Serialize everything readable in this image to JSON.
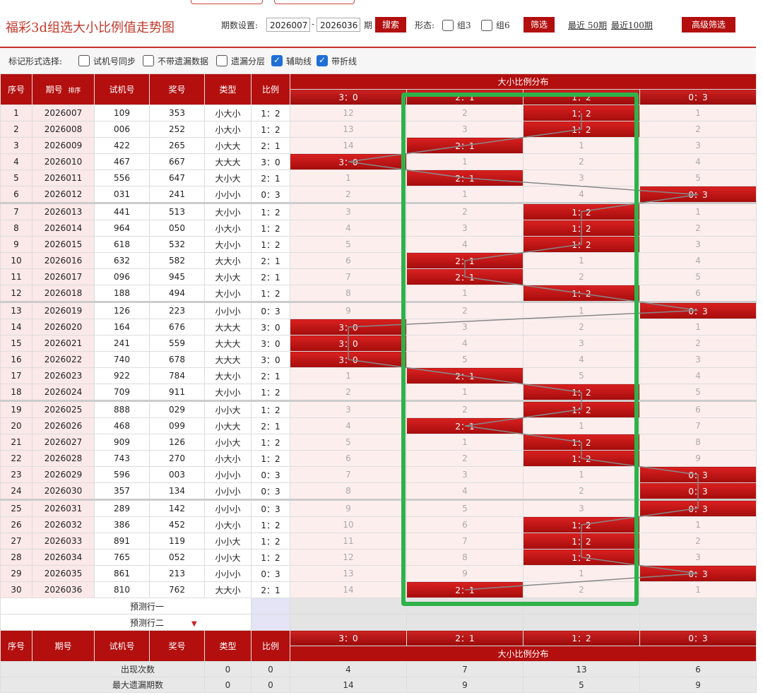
{
  "page": {
    "title": "福彩3d组选大小比例值走势图",
    "period_label": "期数设置:",
    "period_start": "2026007",
    "period_dash": "-",
    "period_end": "2026036",
    "period_unit": "期",
    "search_btn": "搜索",
    "form_label": "形态:",
    "group3": "组3",
    "group6": "组6",
    "filter_btn": "筛选",
    "recent50": "最近 50期",
    "recent100": "最近100期",
    "advanced_btn": "高级筛选"
  },
  "options": {
    "label": "标记形式选择:",
    "items": [
      {
        "label": "试机号同步",
        "checked": false
      },
      {
        "label": "不带遗漏数据",
        "checked": false
      },
      {
        "label": "遗漏分层",
        "checked": false
      },
      {
        "label": "辅助线",
        "checked": true
      },
      {
        "label": "带折线",
        "checked": true
      }
    ]
  },
  "table": {
    "headers": {
      "seq": "序号",
      "period": "期号",
      "sort": "排序",
      "test_no": "试机号",
      "prize_no": "奖号",
      "type": "类型",
      "ratio": "比例",
      "dist_title": "大小比例分布",
      "dist_cols": [
        "3：0",
        "2：1",
        "1：2",
        "0：3"
      ]
    },
    "rows": [
      {
        "seq": "1",
        "period": "2026007",
        "test": "109",
        "prize": "353",
        "type": "小大小",
        "ratio": "1：2",
        "dist": [
          "12",
          "2",
          "1：2",
          "1"
        ],
        "hit": 2
      },
      {
        "seq": "2",
        "period": "2026008",
        "test": "006",
        "prize": "252",
        "type": "小大小",
        "ratio": "1：2",
        "dist": [
          "13",
          "3",
          "1：2",
          "2"
        ],
        "hit": 2
      },
      {
        "seq": "3",
        "period": "2026009",
        "test": "422",
        "prize": "265",
        "type": "小大大",
        "ratio": "2：1",
        "dist": [
          "14",
          "2：1",
          "1",
          "3"
        ],
        "hit": 1
      },
      {
        "seq": "4",
        "period": "2026010",
        "test": "467",
        "prize": "667",
        "type": "大大大",
        "ratio": "3：0",
        "dist": [
          "3：0",
          "1",
          "2",
          "4"
        ],
        "hit": 0
      },
      {
        "seq": "5",
        "period": "2026011",
        "test": "556",
        "prize": "647",
        "type": "大小大",
        "ratio": "2：1",
        "dist": [
          "1",
          "2：1",
          "3",
          "5"
        ],
        "hit": 1
      },
      {
        "seq": "6",
        "period": "2026012",
        "test": "031",
        "prize": "241",
        "type": "小小小",
        "ratio": "0：3",
        "dist": [
          "2",
          "1",
          "4",
          "0：3"
        ],
        "hit": 3
      },
      {
        "seq": "7",
        "period": "2026013",
        "test": "441",
        "prize": "513",
        "type": "大小小",
        "ratio": "1：2",
        "dist": [
          "3",
          "2",
          "1：2",
          "1"
        ],
        "hit": 2
      },
      {
        "seq": "8",
        "period": "2026014",
        "test": "964",
        "prize": "050",
        "type": "小大小",
        "ratio": "1：2",
        "dist": [
          "4",
          "3",
          "1：2",
          "2"
        ],
        "hit": 2
      },
      {
        "seq": "9",
        "period": "2026015",
        "test": "618",
        "prize": "532",
        "type": "大小小",
        "ratio": "1：2",
        "dist": [
          "5",
          "4",
          "1：2",
          "3"
        ],
        "hit": 2
      },
      {
        "seq": "10",
        "period": "2026016",
        "test": "632",
        "prize": "582",
        "type": "大大小",
        "ratio": "2：1",
        "dist": [
          "6",
          "2：1",
          "1",
          "4"
        ],
        "hit": 1
      },
      {
        "seq": "11",
        "period": "2026017",
        "test": "096",
        "prize": "945",
        "type": "大小大",
        "ratio": "2：1",
        "dist": [
          "7",
          "2：1",
          "2",
          "5"
        ],
        "hit": 1
      },
      {
        "seq": "12",
        "period": "2026018",
        "test": "188",
        "prize": "494",
        "type": "大小小",
        "ratio": "1：2",
        "dist": [
          "8",
          "1",
          "1：2",
          "6"
        ],
        "hit": 2
      },
      {
        "seq": "13",
        "period": "2026019",
        "test": "126",
        "prize": "223",
        "type": "小小小",
        "ratio": "0：3",
        "dist": [
          "9",
          "2",
          "1",
          "0：3"
        ],
        "hit": 3
      },
      {
        "seq": "14",
        "period": "2026020",
        "test": "164",
        "prize": "676",
        "type": "大大大",
        "ratio": "3：0",
        "dist": [
          "3：0",
          "3",
          "2",
          "1"
        ],
        "hit": 0
      },
      {
        "seq": "15",
        "period": "2026021",
        "test": "241",
        "prize": "559",
        "type": "大大大",
        "ratio": "3：0",
        "dist": [
          "3：0",
          "4",
          "3",
          "2"
        ],
        "hit": 0
      },
      {
        "seq": "16",
        "period": "2026022",
        "test": "740",
        "prize": "678",
        "type": "大大大",
        "ratio": "3：0",
        "dist": [
          "3：0",
          "5",
          "4",
          "3"
        ],
        "hit": 0
      },
      {
        "seq": "17",
        "period": "2026023",
        "test": "922",
        "prize": "784",
        "type": "大大小",
        "ratio": "2：1",
        "dist": [
          "1",
          "2：1",
          "5",
          "4"
        ],
        "hit": 1
      },
      {
        "seq": "18",
        "period": "2026024",
        "test": "709",
        "prize": "911",
        "type": "大小小",
        "ratio": "1：2",
        "dist": [
          "2",
          "1",
          "1：2",
          "5"
        ],
        "hit": 2
      },
      {
        "seq": "19",
        "period": "2026025",
        "test": "888",
        "prize": "029",
        "type": "小小大",
        "ratio": "1：2",
        "dist": [
          "3",
          "2",
          "1：2",
          "6"
        ],
        "hit": 2
      },
      {
        "seq": "20",
        "period": "2026026",
        "test": "468",
        "prize": "099",
        "type": "小大大",
        "ratio": "2：1",
        "dist": [
          "4",
          "2：1",
          "1",
          "7"
        ],
        "hit": 1
      },
      {
        "seq": "21",
        "period": "2026027",
        "test": "909",
        "prize": "126",
        "type": "小小大",
        "ratio": "1：2",
        "dist": [
          "5",
          "1",
          "1：2",
          "8"
        ],
        "hit": 2
      },
      {
        "seq": "22",
        "period": "2026028",
        "test": "743",
        "prize": "270",
        "type": "小大小",
        "ratio": "1：2",
        "dist": [
          "6",
          "2",
          "1：2",
          "9"
        ],
        "hit": 2
      },
      {
        "seq": "23",
        "period": "2026029",
        "test": "596",
        "prize": "003",
        "type": "小小小",
        "ratio": "0：3",
        "dist": [
          "7",
          "3",
          "1",
          "0：3"
        ],
        "hit": 3
      },
      {
        "seq": "24",
        "period": "2026030",
        "test": "357",
        "prize": "134",
        "type": "小小小",
        "ratio": "0：3",
        "dist": [
          "8",
          "4",
          "2",
          "0：3"
        ],
        "hit": 3
      },
      {
        "seq": "25",
        "period": "2026031",
        "test": "289",
        "prize": "142",
        "type": "小小小",
        "ratio": "0：3",
        "dist": [
          "9",
          "5",
          "3",
          "0：3"
        ],
        "hit": 3
      },
      {
        "seq": "26",
        "period": "2026032",
        "test": "386",
        "prize": "452",
        "type": "小大小",
        "ratio": "1：2",
        "dist": [
          "10",
          "6",
          "1：2",
          "1"
        ],
        "hit": 2
      },
      {
        "seq": "27",
        "period": "2026033",
        "test": "891",
        "prize": "119",
        "type": "小小大",
        "ratio": "1：2",
        "dist": [
          "11",
          "7",
          "1：2",
          "2"
        ],
        "hit": 2
      },
      {
        "seq": "28",
        "period": "2026034",
        "test": "765",
        "prize": "052",
        "type": "小小大",
        "ratio": "1：2",
        "dist": [
          "12",
          "8",
          "1：2",
          "3"
        ],
        "hit": 2
      },
      {
        "seq": "29",
        "period": "2026035",
        "test": "861",
        "prize": "213",
        "type": "小小小",
        "ratio": "0：3",
        "dist": [
          "13",
          "9",
          "1",
          "0：3"
        ],
        "hit": 3
      },
      {
        "seq": "30",
        "period": "2026036",
        "test": "810",
        "prize": "762",
        "type": "大大小",
        "ratio": "2：1",
        "dist": [
          "14",
          "2：1",
          "2",
          "1"
        ],
        "hit": 1
      }
    ],
    "predict1": "预测行一",
    "predict2": "预测行二",
    "stats": [
      {
        "label": "出现次数",
        "type": "0",
        "ratio": "0",
        "vals": [
          "4",
          "7",
          "13",
          "6"
        ]
      },
      {
        "label": "最大遗漏期数",
        "type": "0",
        "ratio": "0",
        "vals": [
          "14",
          "9",
          "5",
          "9"
        ]
      }
    ]
  },
  "colors": {
    "accent": "#b30f0f",
    "highlight_box": "#2fb24a",
    "checkbox": "#1e6fd6"
  }
}
